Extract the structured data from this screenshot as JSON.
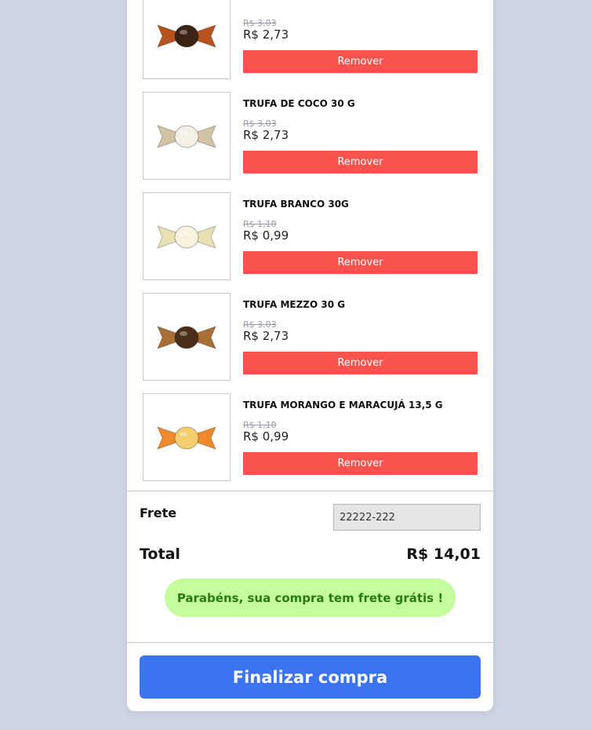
{
  "items": [
    {
      "name": "",
      "old_price": "R$ 3,03",
      "price": "R$ 2,73",
      "remove_label": "Remover",
      "image": "chocolate-truffle-icon",
      "wrapper_color": "#b8531f",
      "ball_color": "#3a2313"
    },
    {
      "name": "TRUFA DE COCO 30 G",
      "old_price": "R$ 3,03",
      "price": "R$ 2,73",
      "remove_label": "Remover",
      "image": "coconut-truffle-icon",
      "wrapper_color": "#d2c3a4",
      "ball_color": "#f4f0e6"
    },
    {
      "name": "TRUFA BRANCO 30G",
      "old_price": "R$ 1,10",
      "price": "R$ 0,99",
      "remove_label": "Remover",
      "image": "white-truffle-icon",
      "wrapper_color": "#e8e0b3",
      "ball_color": "#f7f3de"
    },
    {
      "name": "TRUFA MEZZO 30 G",
      "old_price": "R$ 3,03",
      "price": "R$ 2,73",
      "remove_label": "Remover",
      "image": "mezzo-truffle-icon",
      "wrapper_color": "#a76e36",
      "ball_color": "#4a2e18"
    },
    {
      "name": "TRUFA MORANGO E MARACUJÁ 13,5 G",
      "old_price": "R$ 1,10",
      "price": "R$ 0,99",
      "remove_label": "Remover",
      "image": "strawberry-passionfruit-truffle-icon",
      "wrapper_color": "#ef8a2c",
      "ball_color": "#f6ce6d"
    }
  ],
  "shipping": {
    "label": "Frete",
    "cep_value": "22222-222"
  },
  "total": {
    "label": "Total",
    "value": "R$ 14,01"
  },
  "free_shipping_message": "Parabéns, sua compra tem frete grátis !",
  "checkout_label": "Finalizar compra"
}
